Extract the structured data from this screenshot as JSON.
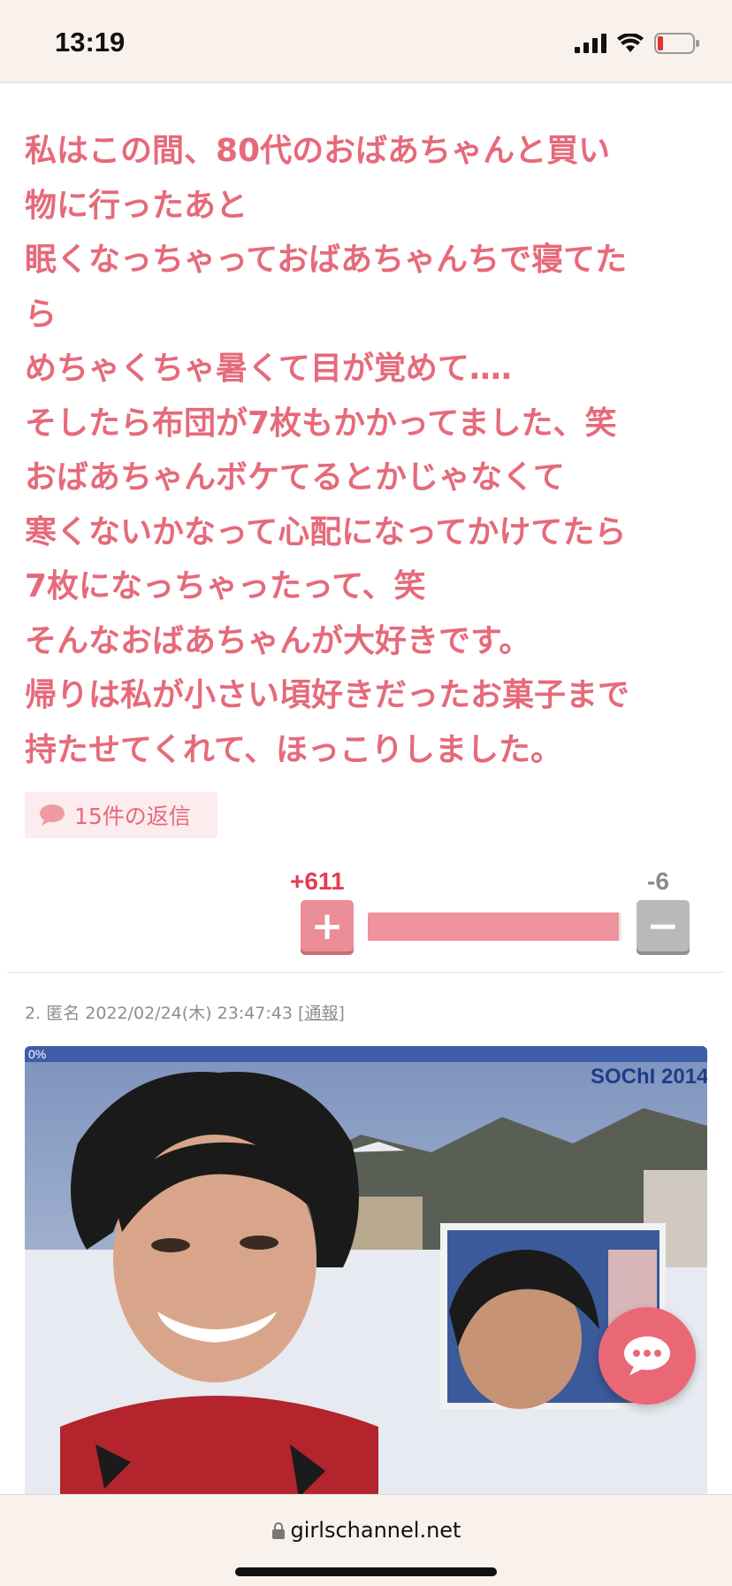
{
  "status_bar": {
    "time": "13:19"
  },
  "comment": {
    "lines": [
      "私はこの間、80代のおばあちゃんと買い",
      "物に行ったあと",
      "眠くなっちゃっておばあちゃんちで寝てた",
      "ら",
      "めちゃくちゃ暑くて目が覚めて‥‥",
      "そしたら布団が7枚もかかってました、笑",
      "おばあちゃんボケてるとかじゃなくて",
      "寒くないかなって心配になってかけてたら",
      "7枚になっちゃったって、笑",
      "そんなおばあちゃんが大好きです。",
      "帰りは私が小さい頃好きだったお菓子まで",
      "持たせてくれて、ほっこりしました。"
    ],
    "replies_label": "15件の返信",
    "votes": {
      "plus_label": "+611",
      "minus_label": "-6",
      "plus_symbol": "+",
      "minus_symbol": "−",
      "plus_share": 0.99
    }
  },
  "next_comment": {
    "number": "2.",
    "author": "匿名",
    "datetime": "2022/02/24(木) 23:47:43",
    "report_label": "通報",
    "image_overlay_text": "SOChI 2014"
  },
  "browser": {
    "url": "girlschannel.net"
  },
  "colors": {
    "accent": "#e66a7a",
    "plus": "#e23d50",
    "fab": "#ea6875"
  }
}
